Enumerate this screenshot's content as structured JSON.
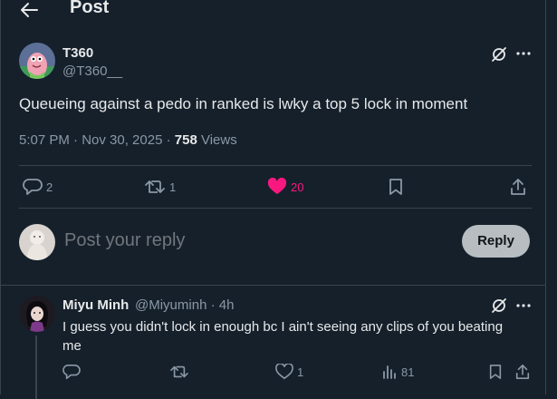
{
  "header": {
    "title": "Post"
  },
  "post": {
    "author_name": "T360",
    "author_handle": "@T360__",
    "text": "Queueing against a pedo in ranked is lwky a top 5 lock in moment",
    "timestamp": "5:07 PM · Nov 30, 2025 · ",
    "views_count": "758",
    "views_label": " Views",
    "actions": {
      "replies": "2",
      "reposts": "1",
      "likes": "20"
    },
    "liked": true
  },
  "composer": {
    "placeholder": "Post your reply",
    "button_label": "Reply"
  },
  "reply": {
    "author_name": "Miyu Minh",
    "author_handle": "@Miyuminh · 4h",
    "text": "I guess you didn't lock in enough bc I ain't seeing any clips of you beating me",
    "actions": {
      "replies": "",
      "reposts": "",
      "likes": "1",
      "views": "81"
    }
  },
  "colors": {
    "background": "#15202b",
    "text": "#e7e9ea",
    "muted": "#8b98a5",
    "like": "#f91880",
    "border": "#38444d"
  }
}
